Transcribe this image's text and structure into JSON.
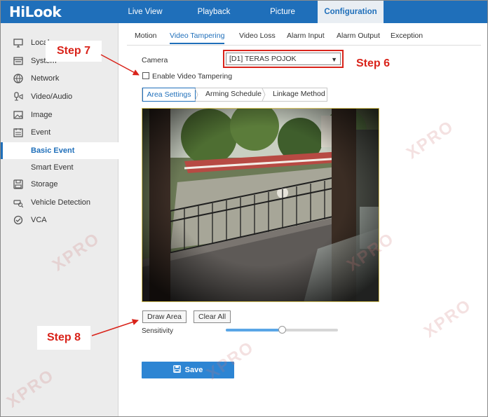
{
  "brand": {
    "logo": "HiLook"
  },
  "topnav": {
    "items": [
      {
        "label": "Live View"
      },
      {
        "label": "Playback"
      },
      {
        "label": "Picture"
      },
      {
        "label": "Configuration"
      }
    ]
  },
  "sidebar": {
    "items": [
      {
        "label": "Local",
        "icon": "monitor-icon"
      },
      {
        "label": "System",
        "icon": "system-icon"
      },
      {
        "label": "Network",
        "icon": "globe-icon"
      },
      {
        "label": "Video/Audio",
        "icon": "camera-mic-icon"
      },
      {
        "label": "Image",
        "icon": "image-icon"
      },
      {
        "label": "Event",
        "icon": "calendar-icon"
      },
      {
        "label": "Basic Event"
      },
      {
        "label": "Smart Event"
      },
      {
        "label": "Storage",
        "icon": "disk-icon"
      },
      {
        "label": "Vehicle Detection",
        "icon": "car-search-icon"
      },
      {
        "label": "VCA",
        "icon": "vca-icon"
      }
    ]
  },
  "subtabs": [
    "Motion",
    "Video Tampering",
    "Video Loss",
    "Alarm Input",
    "Alarm Output",
    "Exception"
  ],
  "form": {
    "camera_label": "Camera",
    "camera_value": "[D1] TERAS POJOK",
    "enable_label": "Enable Video Tampering",
    "enable_checked": false
  },
  "segments": [
    "Area Settings",
    "Arming Schedule",
    "Linkage Method"
  ],
  "buttons": {
    "draw_area": "Draw Area",
    "clear_all": "Clear All",
    "save": "Save"
  },
  "sensitivity": {
    "label": "Sensitivity",
    "value_fraction": 0.5
  },
  "annotations": {
    "step6": "Step 6",
    "step7": "Step 7",
    "step8": "Step 8"
  },
  "watermark": {
    "text": "XPRO"
  },
  "colors": {
    "brand_blue": "#1f6fba",
    "annotation_red": "#d9231a",
    "save_blue": "#2d85d3"
  }
}
